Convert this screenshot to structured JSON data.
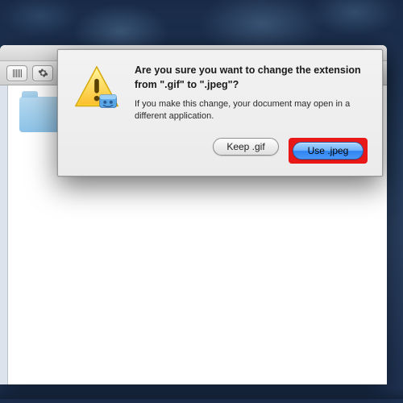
{
  "dialog": {
    "heading": "Are you sure you want to change the extension from \".gif\" to \".jpeg\"?",
    "subtext": "If you make this change, your document may open in a different application.",
    "keep_label": "Keep .gif",
    "use_label": "Use .jpeg"
  },
  "colors": {
    "highlight": "#e81818",
    "aqua_blue": "#4a97f8"
  }
}
